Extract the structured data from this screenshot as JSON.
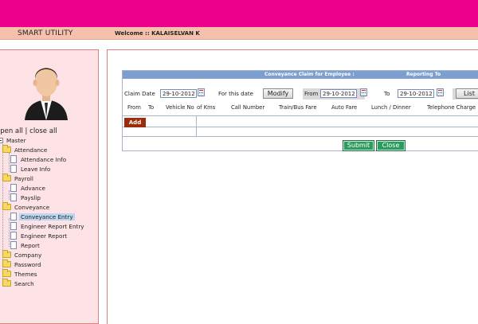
{
  "header": {
    "brand": "SMART UTILITY",
    "welcome": "Welcome :: KALAISELVAN K"
  },
  "sidebar": {
    "open_all": "open all",
    "separator": " | ",
    "close_all": "close all",
    "tree": {
      "root": "Master",
      "attendance": "Attendance",
      "attendance_info": "Attendance Info",
      "leave_info": "Leave Info",
      "payroll": "Payroll",
      "advance": "Advance",
      "payslip": "Payslip",
      "conveyance": "Conveyance",
      "conveyance_entry": "Conveyance Entry",
      "engineer_report_entry": "Engineer Report Entry",
      "engineer_report": "Engineer Report",
      "report": "Report",
      "company": "Company",
      "password": "Password",
      "themes": "Themes",
      "search": "Search"
    },
    "active_item": "Conveyance Entry"
  },
  "form": {
    "title": "Conveyance Claim for Employee :",
    "reporting_to": "Reporting To",
    "claim_date_label": "Claim Date",
    "claim_date_value": "29-10-2012",
    "for_this_date_label": "For this date",
    "modify_label": "Modify",
    "from_label": "From",
    "from_value": "29-10-2012",
    "to_label": "To",
    "to_value": "29-10-2012",
    "list_label": "List",
    "columns": [
      "From",
      "To",
      "Vehicle No",
      "of Kms",
      "Call Number",
      "Train/Bus Fare",
      "Auto Fare",
      "Lunch / Dinner",
      "Telephone Charge"
    ],
    "add_label": "Add",
    "submit_label": "Submit",
    "close_label": "Close"
  },
  "colors": {
    "top_bar": "#ec008c",
    "sub_bar": "#f5c1ad",
    "sidebar_bg": "#fde3e5",
    "form_header": "#7d9fd0",
    "add_button": "#9b2c0c",
    "action_button": "#2e9a5f"
  }
}
